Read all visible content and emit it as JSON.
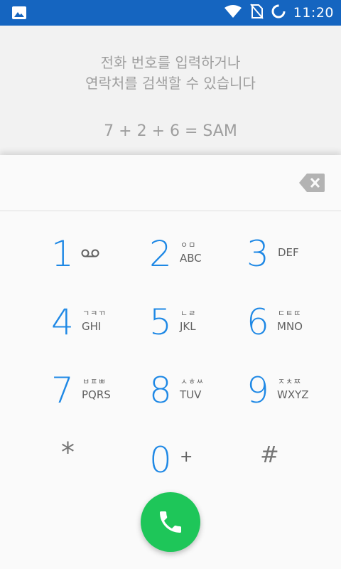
{
  "status_bar": {
    "time": "11:20",
    "icons": [
      "image-icon",
      "wifi-icon",
      "no-sim-icon",
      "sync-icon"
    ]
  },
  "hint": {
    "line1": "전화 번호를 입력하거나",
    "line2": "연락처를 검색할 수 있습니다",
    "example": "7 + 2 + 6 = SAM"
  },
  "dialpad": {
    "digits_value": "",
    "keys": [
      {
        "digit": "1",
        "korean": "",
        "letters": "",
        "extra_icon": "voicemail-icon"
      },
      {
        "digit": "2",
        "korean": "ㅇㅁ",
        "letters": "ABC"
      },
      {
        "digit": "3",
        "korean": "",
        "letters": "DEF"
      },
      {
        "digit": "4",
        "korean": "ㄱㅋㄲ",
        "letters": "GHI"
      },
      {
        "digit": "5",
        "korean": "ㄴㄹ",
        "letters": "JKL"
      },
      {
        "digit": "6",
        "korean": "ㄷㅌㄸ",
        "letters": "MNO"
      },
      {
        "digit": "7",
        "korean": "ㅂㅍㅃ",
        "letters": "PQRS"
      },
      {
        "digit": "8",
        "korean": "ㅅㅎㅆ",
        "letters": "TUV"
      },
      {
        "digit": "9",
        "korean": "ㅈㅊㅉ",
        "letters": "WXYZ"
      },
      {
        "digit": "*",
        "korean": "",
        "letters": ""
      },
      {
        "digit": "0",
        "korean": "",
        "letters": "+"
      },
      {
        "digit": "#",
        "korean": "",
        "letters": ""
      }
    ]
  },
  "colors": {
    "status_bar": "#1565c0",
    "digit": "#1e88e5",
    "call_button": "#1ec659",
    "hint_text": "#9e9e9e"
  }
}
